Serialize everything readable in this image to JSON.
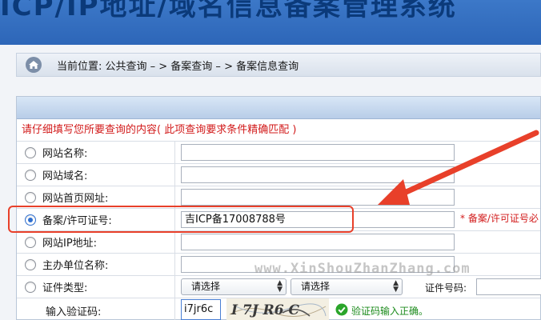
{
  "banner": {
    "title": "ICP/IP地址/域名信息备案管理系统"
  },
  "breadcrumb": {
    "text": "当前位置:  公共查询  – >  备案查询  – > 备案信息查询"
  },
  "form": {
    "instruction": "请仔细填写您所要查询的内容( 此项查询要求条件精确匹配 )",
    "rows": [
      {
        "label": "网站名称:",
        "value": ""
      },
      {
        "label": "网站域名:",
        "value": ""
      },
      {
        "label": "网站首页网址:",
        "value": ""
      },
      {
        "label": "备案/许可证号:",
        "value": "吉ICP备17008788号"
      },
      {
        "label": "网站IP地址:",
        "value": ""
      },
      {
        "label": "主办单位名称:",
        "value": ""
      }
    ],
    "license_hint": "* 备案/许可证号必",
    "cert_type": {
      "label": "证件类型:",
      "select1": "请选择",
      "select2": "请选择",
      "cert_no_label": "证件号码:"
    },
    "captcha": {
      "label": "输入验证码:",
      "value": "i7jr6c",
      "image_text": "I 7J R6 C",
      "status": "验证码输入正确。"
    }
  },
  "watermark": "www.XinShouZhanZhang.com",
  "colors": {
    "accent_red": "#d21b1b",
    "annotation": "#e8402a",
    "success": "#1a8a1a"
  }
}
